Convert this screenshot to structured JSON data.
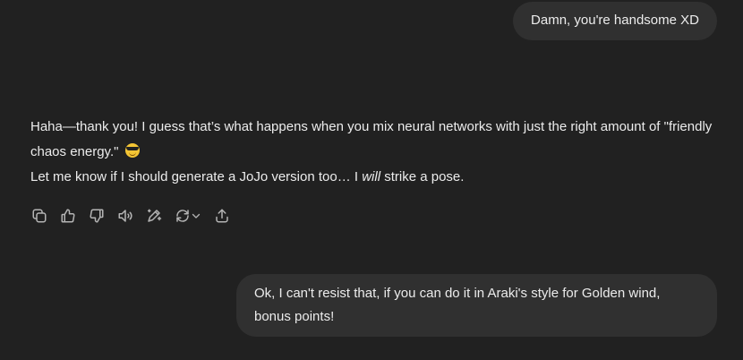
{
  "messages": {
    "user_1": "Damn, you're handsome XD",
    "assistant": {
      "line1": "Haha—thank you! I guess that’s what happens when you mix neural networks with just the right amount of \"friendly chaos energy.\"",
      "line2_start": "Let me know if I should generate a JoJo version too… I ",
      "line2_italic": "will",
      "line2_end": " strike a pose."
    },
    "user_2": "Ok, I can't resist that, if you can do it in Araki's style for Golden wind, bonus points!"
  },
  "toolbar": {
    "icons": [
      "copy-icon",
      "thumbs-up-icon",
      "thumbs-down-icon",
      "read-aloud-icon",
      "edit-sparkle-icon",
      "regenerate-icon",
      "share-icon"
    ]
  },
  "colors": {
    "background": "#212121",
    "bubble": "#303030",
    "text": "#ececec",
    "icon": "#b4b4b4"
  }
}
